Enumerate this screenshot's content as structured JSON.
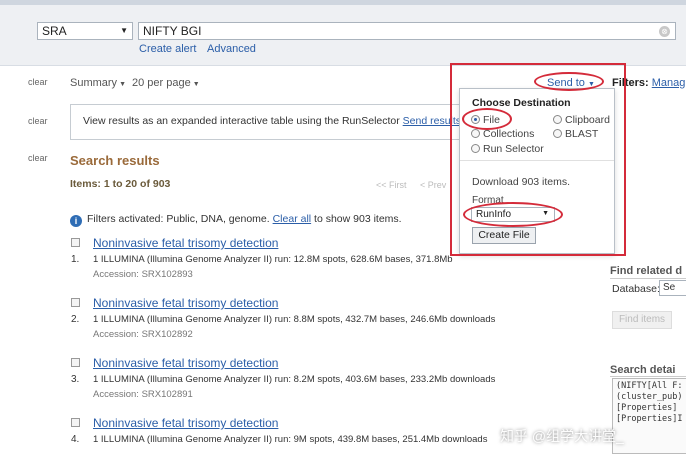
{
  "header": {
    "db_select": "SRA",
    "search_value": "NIFTY BGI",
    "clear_icon": "⊗",
    "create_alert": "Create alert",
    "advanced": "Advanced"
  },
  "toolbar": {
    "clear_label": "clear",
    "summary": "Summary",
    "per_page": "20 per page",
    "send_to": "Send to",
    "filters": "Filters:",
    "manage": "Manag"
  },
  "info_box": {
    "text": "View results as an expanded interactive table using the RunSelector",
    "link": "Send results"
  },
  "results_header": {
    "title": "Search results",
    "items": "Items: 1 to 20 of 903",
    "first": "<< First",
    "prev": "< Prev"
  },
  "filter_line": {
    "text_before": "Filters activated: Public, DNA, genome.",
    "clear_all": "Clear all",
    "text_after": "to show 903 items."
  },
  "results": [
    {
      "num": "1.",
      "title": "Noninvasive fetal trisomy detection",
      "desc": "1 ILLUMINA (Illumina Genome Analyzer II) run: 12.8M spots, 628.6M bases, 371.8Mb",
      "accession": "Accession: SRX102893"
    },
    {
      "num": "2.",
      "title": "Noninvasive fetal trisomy detection",
      "desc": "1 ILLUMINA (Illumina Genome Analyzer II) run: 8.8M spots, 432.7M bases, 246.6Mb downloads",
      "accession": "Accession: SRX102892"
    },
    {
      "num": "3.",
      "title": "Noninvasive fetal trisomy detection",
      "desc": "1 ILLUMINA (Illumina Genome Analyzer II) run: 8.2M spots, 403.6M bases, 233.2Mb downloads",
      "accession": "Accession: SRX102891"
    },
    {
      "num": "4.",
      "title": "Noninvasive fetal trisomy detection",
      "desc": "1 ILLUMINA (Illumina Genome Analyzer II) run: 9M spots, 439.8M bases, 251.4Mb downloads",
      "accession": ""
    }
  ],
  "send_to_panel": {
    "heading": "Choose Destination",
    "options": [
      "File",
      "Clipboard",
      "Collections",
      "BLAST",
      "Run Selector"
    ],
    "selected": "File",
    "download_text": "Download 903 items.",
    "format_label": "Format",
    "format_value": "RunInfo",
    "create_button": "Create File"
  },
  "sidebar": {
    "find_related": "Find related d",
    "database_label": "Database:",
    "database_value": "Se",
    "find_button": "Find items",
    "search_details": "Search detai",
    "details_text": "(NIFTY[All F:\n(cluster_pub)\n[Properties] \n[Properties]I"
  },
  "watermark": "知乎 @组学大讲堂_",
  "colors": {
    "link": "#2b5ea8",
    "annotation": "#d42b3a",
    "heading": "#9a6a3a"
  }
}
